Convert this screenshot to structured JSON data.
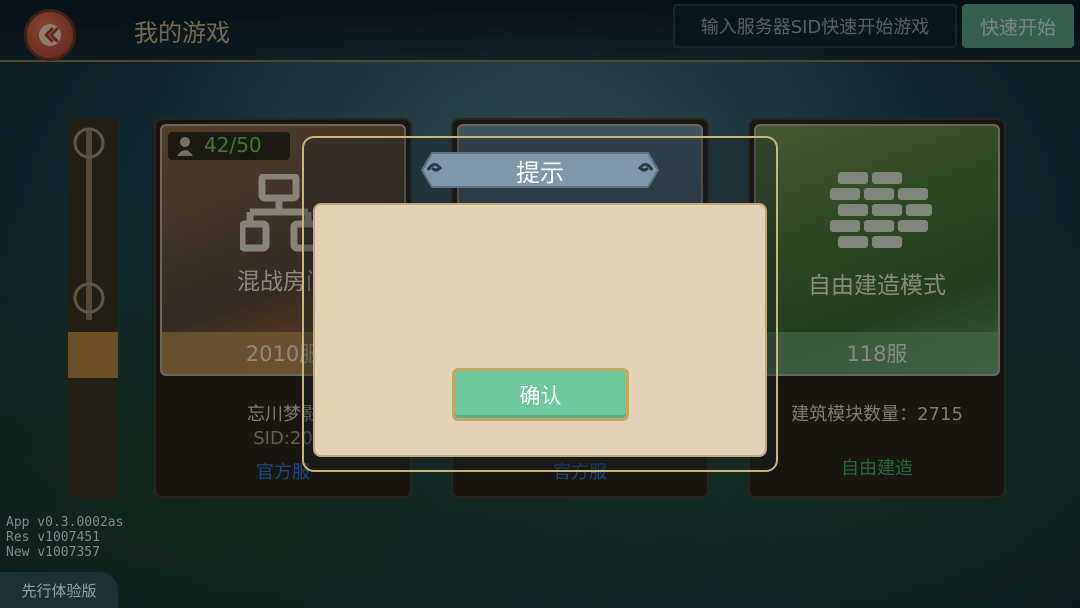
{
  "header": {
    "title": "我的游戏",
    "sid_placeholder": "输入服务器SID快速开始游戏",
    "quick_start": "快速开始"
  },
  "cards": [
    {
      "player_count": "42/50",
      "mode_label": "混战房间",
      "server": "2010服",
      "name": "忘川梦影",
      "sid": "SID:20",
      "tag": "官方服"
    },
    {
      "tag": "官方服"
    },
    {
      "mode_label": "自由建造模式",
      "server": "118服",
      "info": "建筑模块数量：2715",
      "tag": "自由建造"
    }
  ],
  "dialog": {
    "title": "提示",
    "message": "",
    "confirm": "确认"
  },
  "version": {
    "app": "App  v0.3.0002as",
    "res": "Res   v1007451",
    "new": "New  v1007357"
  },
  "badge": "先行体验版",
  "colors": {
    "accent_green": "#6dc99c",
    "frame_gold": "#c9b47a",
    "tag_blue": "#2f7bd6",
    "tag_green": "#3bb55a"
  }
}
